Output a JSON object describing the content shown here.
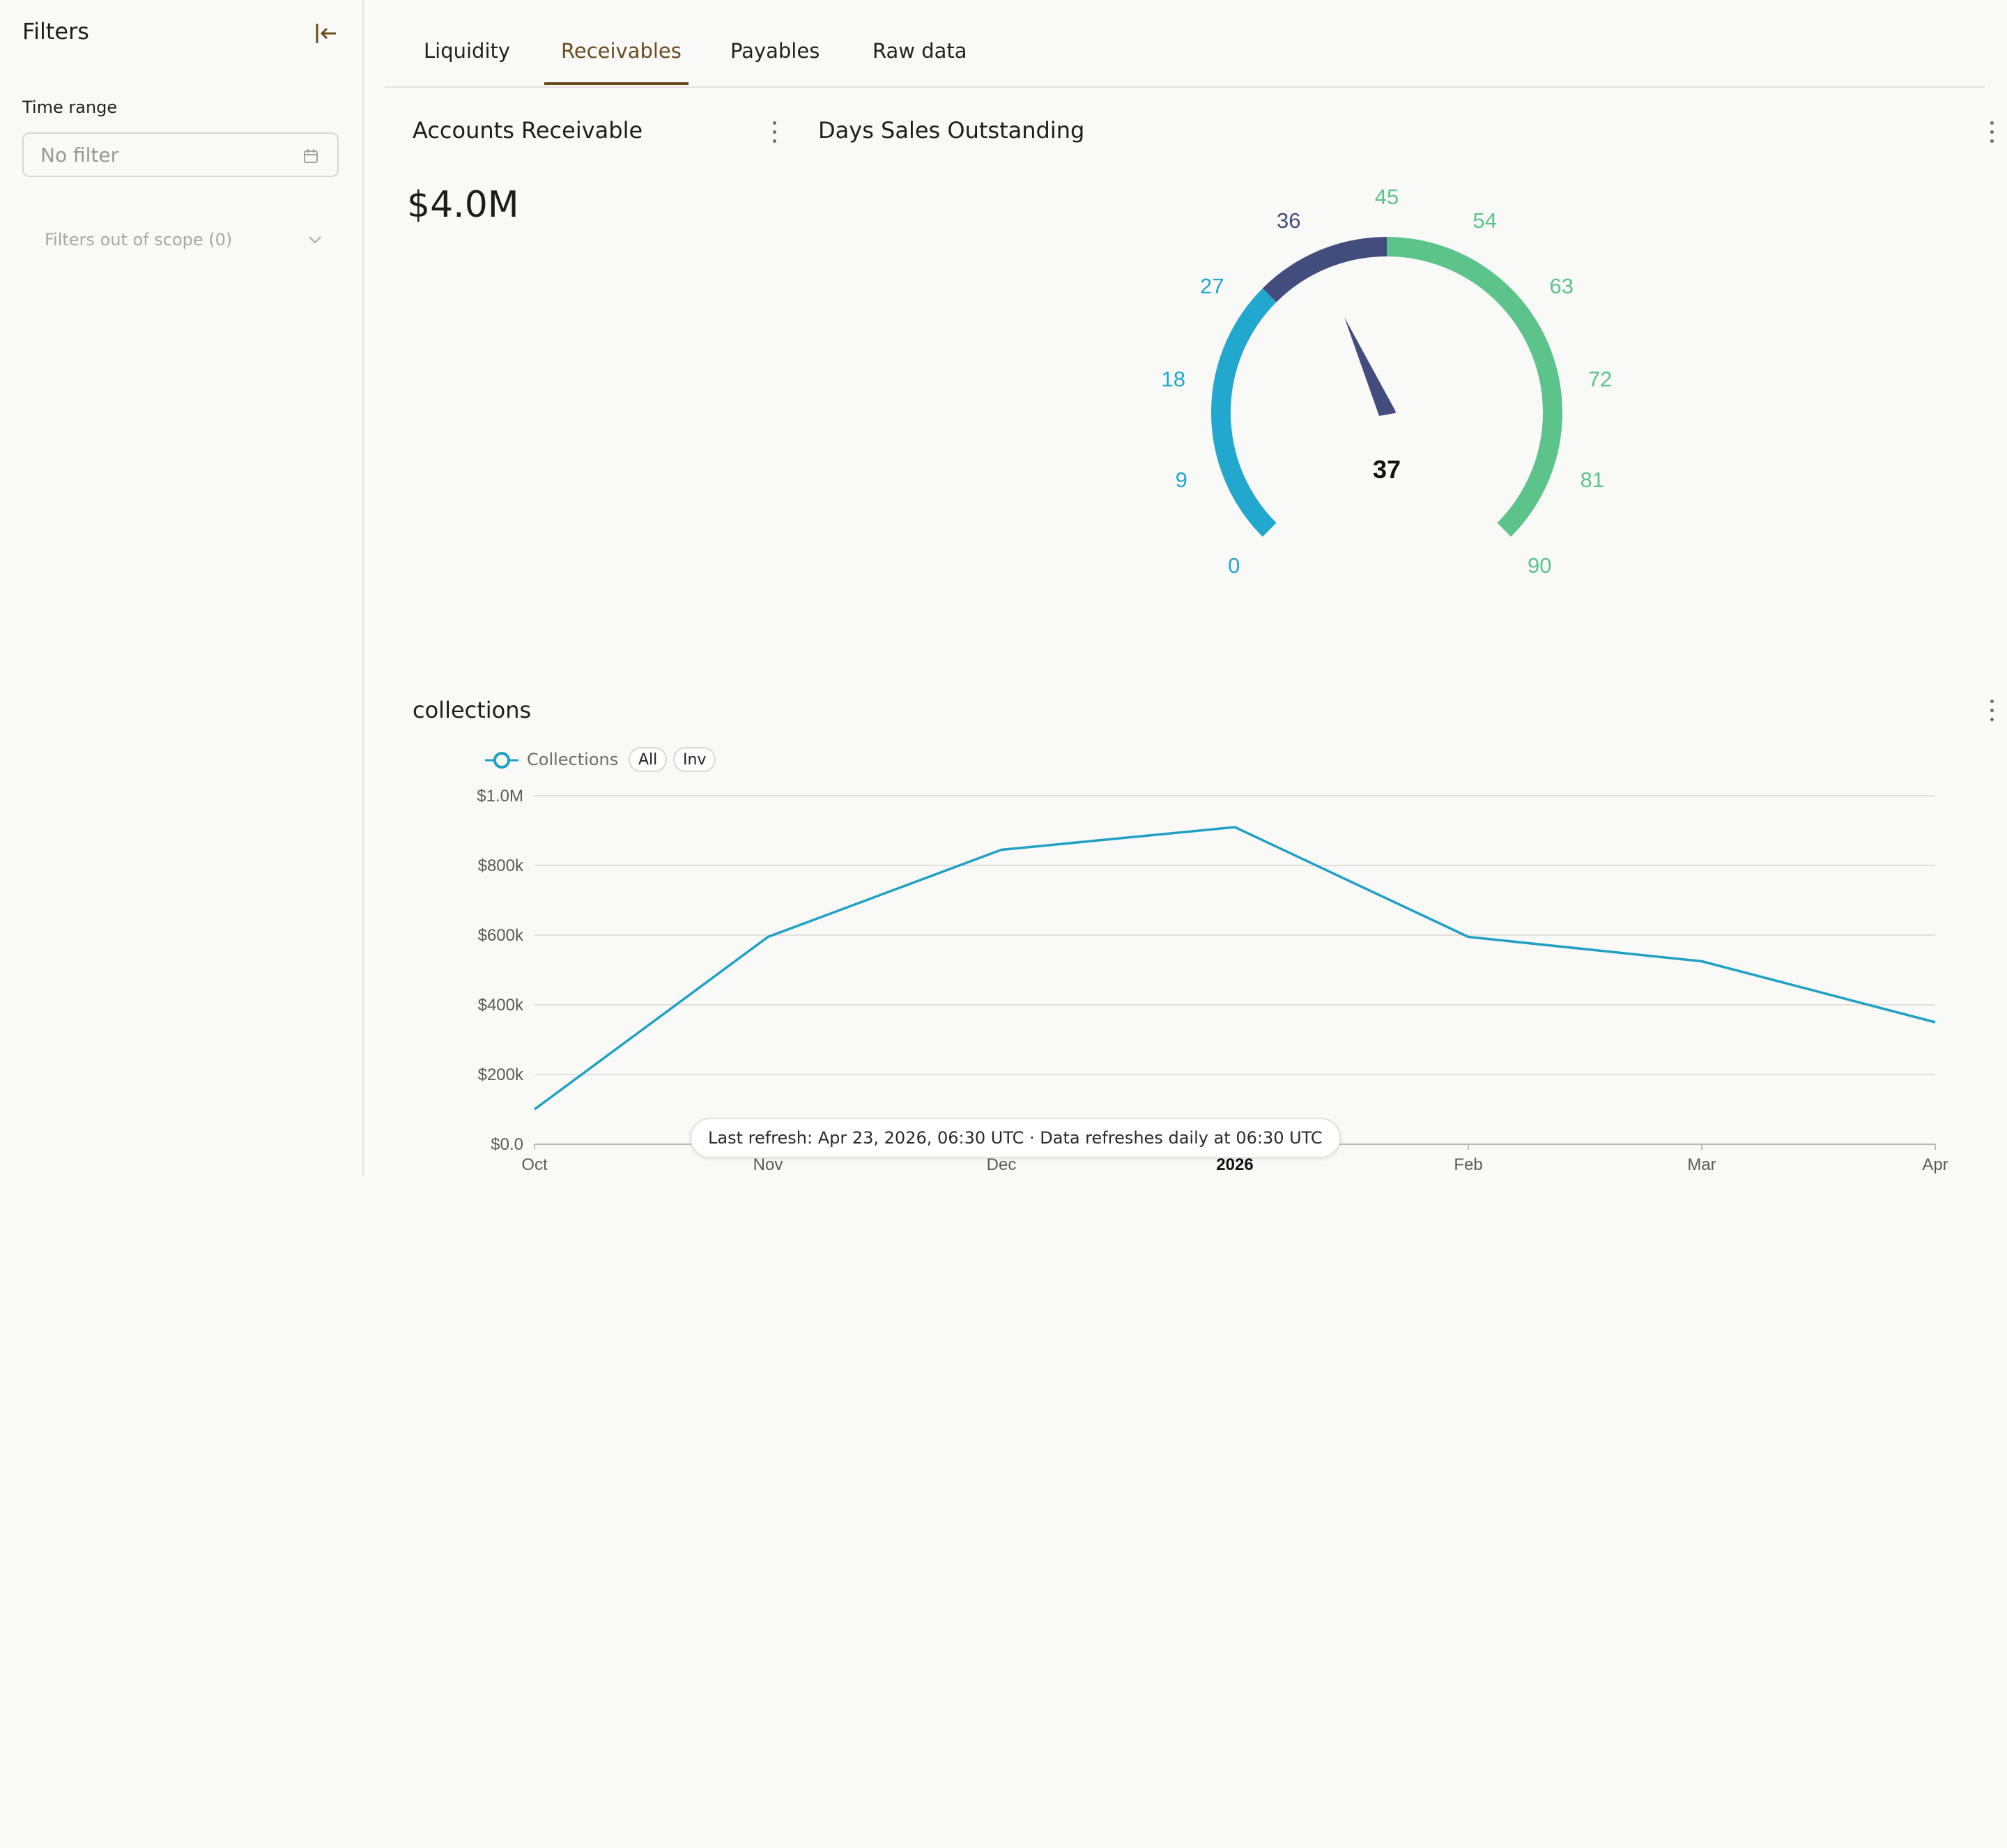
{
  "sidebar": {
    "title": "Filters",
    "time_range_label": "Time range",
    "time_range_placeholder": "No filter",
    "out_of_scope": "Filters out of scope (0)"
  },
  "tabs": [
    {
      "label": "Liquidity",
      "active": false
    },
    {
      "label": "Receivables",
      "active": true
    },
    {
      "label": "Payables",
      "active": false
    },
    {
      "label": "Raw data",
      "active": false
    }
  ],
  "colors": {
    "accent": "#6a4d1f",
    "series": "#21a0c4",
    "gauge_low": "#22a7cf",
    "gauge_mid": "#424c7d",
    "gauge_high": "#5cc38a"
  },
  "kpi": {
    "title": "Accounts Receivable",
    "value": "$4.0M"
  },
  "gauge": {
    "title": "Days Sales Outstanding",
    "min": 0,
    "max": 90,
    "value": 37,
    "value_label": "37",
    "ticks": [
      0,
      9,
      18,
      27,
      36,
      45,
      54,
      63,
      72,
      81,
      90
    ],
    "tick_labels": [
      "0",
      "9",
      "18",
      "27",
      "36",
      "45",
      "54",
      "63",
      "72",
      "81",
      "90"
    ],
    "bands": [
      {
        "from": 0,
        "to": 30,
        "color": "#22a7cf"
      },
      {
        "from": 30,
        "to": 45,
        "color": "#424c7d"
      },
      {
        "from": 45,
        "to": 90,
        "color": "#5cc38a"
      }
    ]
  },
  "collections": {
    "title": "collections",
    "legend_label": "Collections",
    "chip_all": "All",
    "chip_inv": "Inv"
  },
  "chart_data": {
    "type": "line",
    "title": "collections",
    "x": [
      "Oct",
      "Nov",
      "Dec",
      "2026",
      "Feb",
      "Mar",
      "Apr"
    ],
    "x_bold": "2026",
    "series": [
      {
        "name": "Collections",
        "values": [
          100000,
          595000,
          845000,
          910000,
          595000,
          525000,
          350000
        ]
      }
    ],
    "ylim": [
      0,
      1000000
    ],
    "y_ticks": [
      0,
      200000,
      400000,
      600000,
      800000,
      1000000
    ],
    "y_tick_labels": [
      "$0.0",
      "$200k",
      "$400k",
      "$600k",
      "$800k",
      "$1.0M"
    ],
    "grid": true,
    "legend": "top-left"
  },
  "footer": {
    "refresh_text": "Last refresh: Apr 23, 2026, 06:30 UTC · Data refreshes daily at 06:30 UTC"
  }
}
